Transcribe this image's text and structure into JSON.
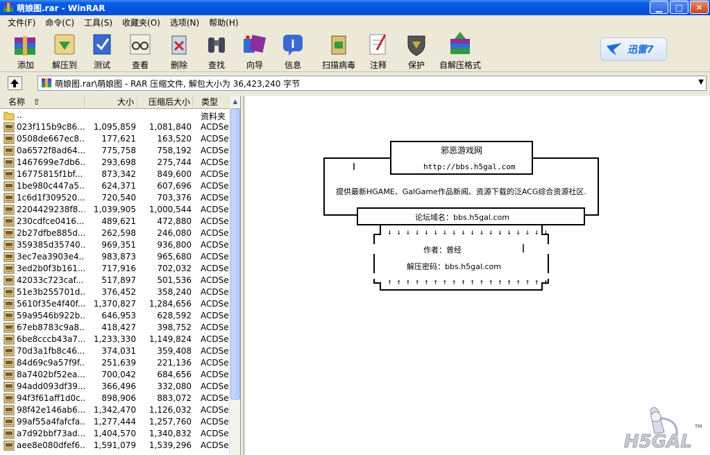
{
  "window": {
    "title": "萌娘图.rar - WinRAR",
    "minimize_label": "▁",
    "maximize_label": "□",
    "close_label": "✕"
  },
  "menu": [
    "文件(F)",
    "命令(C)",
    "工具(S)",
    "收藏夹(O)",
    "选项(N)",
    "帮助(H)"
  ],
  "toolbar": [
    {
      "label": "添加",
      "icon": "add-books-icon"
    },
    {
      "label": "解压到",
      "icon": "extract-to-icon"
    },
    {
      "label": "测试",
      "icon": "test-icon"
    },
    {
      "label": "查看",
      "icon": "view-glasses-icon"
    },
    {
      "label": "删除",
      "icon": "delete-icon"
    },
    {
      "label": "查找",
      "icon": "find-binoculars-icon"
    },
    {
      "label": "向导",
      "icon": "wizard-icon"
    },
    {
      "label": "信息",
      "icon": "info-icon"
    },
    {
      "label": "扫描病毒",
      "icon": "virus-scan-icon"
    },
    {
      "label": "注释",
      "icon": "comment-icon"
    },
    {
      "label": "保护",
      "icon": "protect-shield-icon"
    },
    {
      "label": "自解压格式",
      "icon": "sfx-icon"
    }
  ],
  "xunlei_label": "迅雷7",
  "address": {
    "path": "萌娘图.rar\\萌娘图 - RAR 压缩文件, 解包大小为 36,423,240 字节"
  },
  "file_list": {
    "headers": {
      "name": "名称",
      "size": "大小",
      "packed": "压缩后大小",
      "type": "类型"
    },
    "parent": {
      "name": "..",
      "type": "资料夹"
    },
    "rows": [
      {
        "name": "023f115b9c86...",
        "size": "1,095,859",
        "packed": "1,081,840",
        "type": "ACDSee"
      },
      {
        "name": "0508de667ec8...",
        "size": "177,621",
        "packed": "163,520",
        "type": "ACDSee"
      },
      {
        "name": "0a6572f8ad64...",
        "size": "775,758",
        "packed": "758,192",
        "type": "ACDSee"
      },
      {
        "name": "1467699e7db6...",
        "size": "293,698",
        "packed": "275,744",
        "type": "ACDSee"
      },
      {
        "name": "16775815f1bf...",
        "size": "873,342",
        "packed": "849,600",
        "type": "ACDSee"
      },
      {
        "name": "1be980c447a5...",
        "size": "624,371",
        "packed": "607,696",
        "type": "ACDSee"
      },
      {
        "name": "1c6d1f309520...",
        "size": "720,540",
        "packed": "703,376",
        "type": "ACDSee"
      },
      {
        "name": "2204429238f8...",
        "size": "1,039,905",
        "packed": "1,000,544",
        "type": "ACDSee"
      },
      {
        "name": "230cdfce0416...",
        "size": "489,621",
        "packed": "472,880",
        "type": "ACDSee"
      },
      {
        "name": "2b27dfbe885d...",
        "size": "262,598",
        "packed": "246,080",
        "type": "ACDSee"
      },
      {
        "name": "359385d35740...",
        "size": "969,351",
        "packed": "936,800",
        "type": "ACDSee"
      },
      {
        "name": "3ec7ea3903e4...",
        "size": "983,873",
        "packed": "965,680",
        "type": "ACDSee"
      },
      {
        "name": "3ed2b0f3b161...",
        "size": "717,916",
        "packed": "702,032",
        "type": "ACDSee"
      },
      {
        "name": "42033c723caf...",
        "size": "517,897",
        "packed": "501,536",
        "type": "ACDSee"
      },
      {
        "name": "51e3b255701d...",
        "size": "376,452",
        "packed": "358,240",
        "type": "ACDSee"
      },
      {
        "name": "5610f35e4f40f...",
        "size": "1,370,827",
        "packed": "1,284,656",
        "type": "ACDSee"
      },
      {
        "name": "59a9546b922b...",
        "size": "646,953",
        "packed": "628,592",
        "type": "ACDSee"
      },
      {
        "name": "67eb8783c9a8...",
        "size": "418,427",
        "packed": "398,752",
        "type": "ACDSee"
      },
      {
        "name": "6be8cccb43a7...",
        "size": "1,233,330",
        "packed": "1,149,824",
        "type": "ACDSee"
      },
      {
        "name": "70d3a1fb8c46...",
        "size": "374,031",
        "packed": "359,408",
        "type": "ACDSee"
      },
      {
        "name": "84d69c9a57f9f...",
        "size": "251,639",
        "packed": "221,136",
        "type": "ACDSee"
      },
      {
        "name": "8a7402bf52ea...",
        "size": "700,042",
        "packed": "684,656",
        "type": "ACDSee"
      },
      {
        "name": "94add093df39...",
        "size": "366,496",
        "packed": "332,080",
        "type": "ACDSee"
      },
      {
        "name": "94f3f61aff1d0c...",
        "size": "898,906",
        "packed": "883,072",
        "type": "ACDSee"
      },
      {
        "name": "98f42e146ab6...",
        "size": "1,342,470",
        "packed": "1,126,032",
        "type": "ACDSee"
      },
      {
        "name": "99af55a4fafcfa...",
        "size": "1,277,444",
        "packed": "1,257,760",
        "type": "ACDSee"
      },
      {
        "name": "a7d92bbf73ad...",
        "size": "1,404,570",
        "packed": "1,340,832",
        "type": "ACDSee"
      },
      {
        "name": "aee8e080dfef6...",
        "size": "1,591,079",
        "packed": "1,539,296",
        "type": "ACDSee"
      }
    ]
  },
  "comment": {
    "site_name": "邪恶游戏网",
    "site_url": "http://bbs.h5gal.com",
    "tagline": "提供最新HGAME、GalGame作品新闻、资源下载的泛ACG综合资源社区.",
    "forum_domain": "论坛域名：bbs.h5gal.com",
    "down_arrows": "↓ ↓ ↓ ↓ ↓ ↓ ↓ ↓ ↓ ↓ ↓ ↓ ↓ ↓ ↓ ↓ ↓ ↓",
    "author": "作者：曾经",
    "password": "解压密码：bbs.h5gal.com",
    "up_arrows": "↑ ↑ ↑ ↑ ↑ ↑ ↑ ↑ ↑ ↑ ↑ ↑ ↑ ↑ ↑ ↑ ↑ ↑"
  },
  "logo": {
    "text": "H5GAL",
    "tm": "TM"
  }
}
